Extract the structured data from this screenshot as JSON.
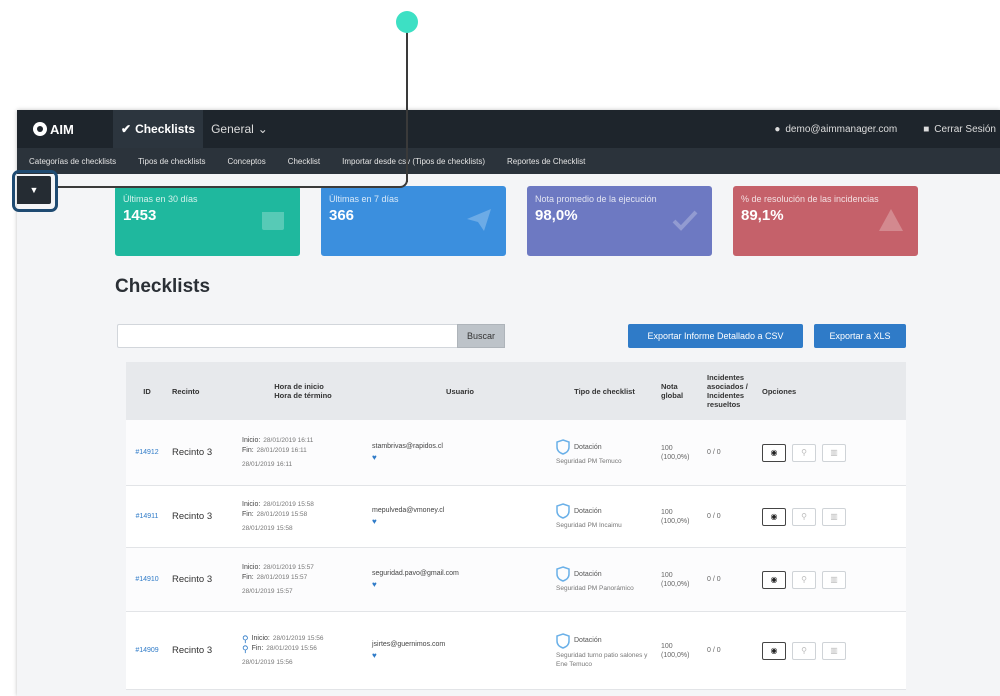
{
  "app": {
    "logo": "AIM",
    "nav": [
      {
        "label": "Checklists",
        "active": true,
        "icon": "check-icon"
      },
      {
        "label": "General",
        "active": false,
        "icon": "caret-down-icon"
      }
    ],
    "user_email": "demo@aimmanager.com",
    "logout_label": "Cerrar Sesión"
  },
  "subnav": [
    "Categorías de checklists",
    "Tipos de checklists",
    "Conceptos",
    "Checklist",
    "Importar desde csv (Tipos de checklists)",
    "Reportes de Checklist"
  ],
  "toggle_icon": "▼",
  "stats": [
    {
      "label": "Últimas en 30 días",
      "value": "1453",
      "color": "#1fb89e",
      "icon": "calendar-icon"
    },
    {
      "label": "Últimas en 7 días",
      "value": "366",
      "color": "#3b8fde",
      "icon": "paper-plane-icon"
    },
    {
      "label": "Nota promedio de la ejecución",
      "value": "98,0%",
      "color": "#6d79c2",
      "icon": "check-icon"
    },
    {
      "label": "% de resolución de las incidencias",
      "value": "89,1%",
      "color": "#c5616a",
      "icon": "warning-icon"
    }
  ],
  "page_title": "Checklists",
  "search": {
    "placeholder": "",
    "button": "Buscar"
  },
  "export": {
    "csv": "Exportar Informe Detallado a CSV",
    "xls": "Exportar a XLS"
  },
  "table": {
    "headers": {
      "id": "ID",
      "recinto": "Recinto",
      "hora": "Hora de inicio\nHora de término",
      "usuario": "Usuario",
      "tipo": "Tipo de checklist",
      "nota": "Nota global",
      "incidentes": "Incidentes asociados / Incidentes resueltos",
      "opciones": "Opciones"
    },
    "rows": [
      {
        "id": "#14912",
        "recinto": "Recinto 3",
        "inicio": "28/01/2019 16:11",
        "fin": "28/01/2019 16:11",
        "extra": "28/01/2019 16:11",
        "pins": false,
        "email": "stambrivas@rapidos.cl",
        "tipo": "Dotación",
        "tipo_sub": "Seguridad PM Temuco",
        "nota": "100 (100,0%)",
        "inc": "0 / 0"
      },
      {
        "id": "#14911",
        "recinto": "Recinto 3",
        "inicio": "28/01/2019 15:58",
        "fin": "28/01/2019 15:58",
        "extra": "28/01/2019 15:58",
        "pins": false,
        "email": "mepulveda@vmoney.cl",
        "tipo": "Dotación",
        "tipo_sub": "Seguridad PM Incaimu",
        "nota": "100 (100,0%)",
        "inc": "0 / 0"
      },
      {
        "id": "#14910",
        "recinto": "Recinto 3",
        "inicio": "28/01/2019 15:57",
        "fin": "28/01/2019 15:57",
        "extra": "28/01/2019 15:57",
        "pins": false,
        "email": "seguridad.pavo@gmail.com",
        "tipo": "Dotación",
        "tipo_sub": "Seguridad PM Panorámico",
        "nota": "100 (100,0%)",
        "inc": "0 / 0"
      },
      {
        "id": "#14909",
        "recinto": "Recinto 3",
        "inicio": "28/01/2019 15:56",
        "fin": "28/01/2019 15:56",
        "extra": "28/01/2019 15:56",
        "pins": true,
        "email": "jsirtes@guernimos.com",
        "tipo": "Dotación",
        "tipo_sub": "Seguridad turno patio salones y Ene Temuco",
        "nota": "100 (100,0%)",
        "inc": "0 / 0"
      }
    ]
  }
}
